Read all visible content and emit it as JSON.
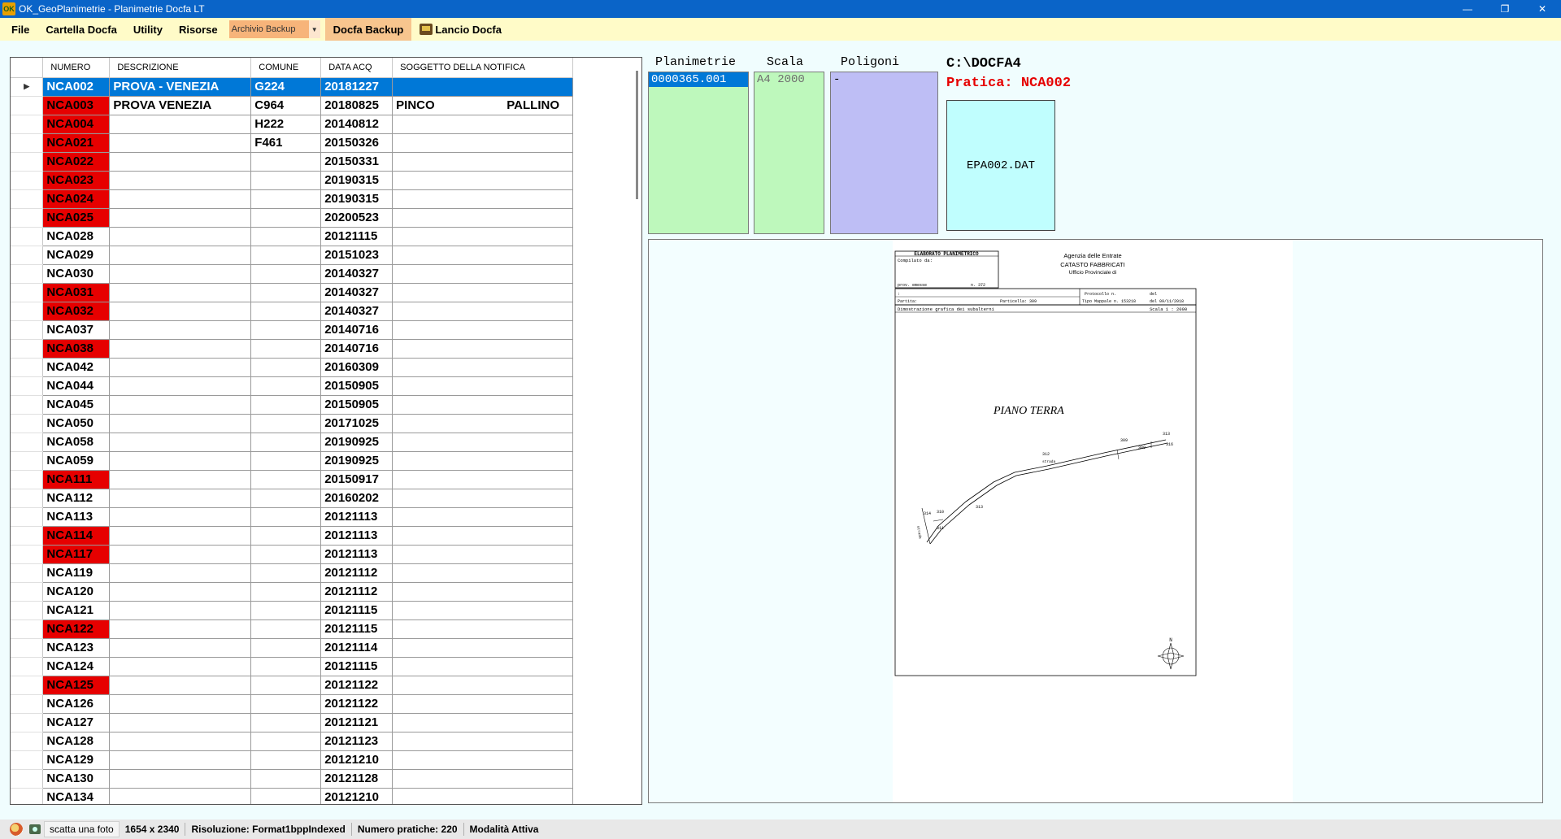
{
  "window": {
    "title": "OK_GeoPlanimetrie - Planimetrie Docfa LT",
    "app_icon": "OK",
    "minimize_icon": "—",
    "maximize_icon": "❐",
    "close_icon": "✕"
  },
  "menu": {
    "file": "File",
    "cartella": "Cartella Docfa",
    "utility": "Utility",
    "risorse": "Risorse",
    "archivio_combo": "Archivio Backup",
    "docfa_backup": "Docfa Backup",
    "lancio": "Lancio Docfa"
  },
  "grid": {
    "headers": [
      "NUMERO",
      "DESCRIZIONE",
      "COMUNE",
      "DATA ACQ",
      "SOGGETTO DELLA NOTIFICA"
    ],
    "row_indicator": "▶",
    "rows": [
      {
        "numero": "NCA002",
        "descrizione": "PROVA - VENEZIA",
        "comune": "G224",
        "data": "20181227",
        "sogg1": "",
        "sogg2": "",
        "red": false,
        "selected": true
      },
      {
        "numero": "NCA003",
        "descrizione": "PROVA VENEZIA",
        "comune": "C964",
        "data": "20180825",
        "sogg1": "PINCO",
        "sogg2": "PALLINO",
        "red": true
      },
      {
        "numero": "NCA004",
        "descrizione": "",
        "comune": "H222",
        "data": "20140812",
        "sogg1": "",
        "sogg2": "",
        "red": true
      },
      {
        "numero": "NCA021",
        "descrizione": "",
        "comune": "F461",
        "data": "20150326",
        "sogg1": "",
        "sogg2": "",
        "red": true
      },
      {
        "numero": "NCA022",
        "descrizione": "",
        "comune": "",
        "data": "20150331",
        "sogg1": "",
        "sogg2": "",
        "red": true
      },
      {
        "numero": "NCA023",
        "descrizione": "",
        "comune": "",
        "data": "20190315",
        "sogg1": "",
        "sogg2": "",
        "red": true
      },
      {
        "numero": "NCA024",
        "descrizione": "",
        "comune": "",
        "data": "20190315",
        "sogg1": "",
        "sogg2": "",
        "red": true
      },
      {
        "numero": "NCA025",
        "descrizione": "",
        "comune": "",
        "data": "20200523",
        "sogg1": "",
        "sogg2": "",
        "red": true
      },
      {
        "numero": "NCA028",
        "descrizione": "",
        "comune": "",
        "data": "20121115",
        "sogg1": "",
        "sogg2": "",
        "red": false
      },
      {
        "numero": "NCA029",
        "descrizione": "",
        "comune": "",
        "data": "20151023",
        "sogg1": "",
        "sogg2": "",
        "red": false
      },
      {
        "numero": "NCA030",
        "descrizione": "",
        "comune": "",
        "data": "20140327",
        "sogg1": "",
        "sogg2": "",
        "red": false
      },
      {
        "numero": "NCA031",
        "descrizione": "",
        "comune": "",
        "data": "20140327",
        "sogg1": "",
        "sogg2": "",
        "red": true
      },
      {
        "numero": "NCA032",
        "descrizione": "",
        "comune": "",
        "data": "20140327",
        "sogg1": "",
        "sogg2": "",
        "red": true
      },
      {
        "numero": "NCA037",
        "descrizione": "",
        "comune": "",
        "data": "20140716",
        "sogg1": "",
        "sogg2": "",
        "red": false
      },
      {
        "numero": "NCA038",
        "descrizione": "",
        "comune": "",
        "data": "20140716",
        "sogg1": "",
        "sogg2": "",
        "red": true
      },
      {
        "numero": "NCA042",
        "descrizione": "",
        "comune": "",
        "data": "20160309",
        "sogg1": "",
        "sogg2": "",
        "red": false
      },
      {
        "numero": "NCA044",
        "descrizione": "",
        "comune": "",
        "data": "20150905",
        "sogg1": "",
        "sogg2": "",
        "red": false
      },
      {
        "numero": "NCA045",
        "descrizione": "",
        "comune": "",
        "data": "20150905",
        "sogg1": "",
        "sogg2": "",
        "red": false
      },
      {
        "numero": "NCA050",
        "descrizione": "",
        "comune": "",
        "data": "20171025",
        "sogg1": "",
        "sogg2": "",
        "red": false
      },
      {
        "numero": "NCA058",
        "descrizione": "",
        "comune": "",
        "data": "20190925",
        "sogg1": "",
        "sogg2": "",
        "red": false
      },
      {
        "numero": "NCA059",
        "descrizione": "",
        "comune": "",
        "data": "20190925",
        "sogg1": "",
        "sogg2": "",
        "red": false
      },
      {
        "numero": "NCA111",
        "descrizione": "",
        "comune": "",
        "data": "20150917",
        "sogg1": "",
        "sogg2": "",
        "red": true
      },
      {
        "numero": "NCA112",
        "descrizione": "",
        "comune": "",
        "data": "20160202",
        "sogg1": "",
        "sogg2": "",
        "red": false
      },
      {
        "numero": "NCA113",
        "descrizione": "",
        "comune": "",
        "data": "20121113",
        "sogg1": "",
        "sogg2": "",
        "red": false
      },
      {
        "numero": "NCA114",
        "descrizione": "",
        "comune": "",
        "data": "20121113",
        "sogg1": "",
        "sogg2": "",
        "red": true
      },
      {
        "numero": "NCA117",
        "descrizione": "",
        "comune": "",
        "data": "20121113",
        "sogg1": "",
        "sogg2": "",
        "red": true
      },
      {
        "numero": "NCA119",
        "descrizione": "",
        "comune": "",
        "data": "20121112",
        "sogg1": "",
        "sogg2": "",
        "red": false
      },
      {
        "numero": "NCA120",
        "descrizione": "",
        "comune": "",
        "data": "20121112",
        "sogg1": "",
        "sogg2": "",
        "red": false
      },
      {
        "numero": "NCA121",
        "descrizione": "",
        "comune": "",
        "data": "20121115",
        "sogg1": "",
        "sogg2": "",
        "red": false
      },
      {
        "numero": "NCA122",
        "descrizione": "",
        "comune": "",
        "data": "20121115",
        "sogg1": "",
        "sogg2": "",
        "red": true
      },
      {
        "numero": "NCA123",
        "descrizione": "",
        "comune": "",
        "data": "20121114",
        "sogg1": "",
        "sogg2": "",
        "red": false
      },
      {
        "numero": "NCA124",
        "descrizione": "",
        "comune": "",
        "data": "20121115",
        "sogg1": "",
        "sogg2": "",
        "red": false
      },
      {
        "numero": "NCA125",
        "descrizione": "",
        "comune": "",
        "data": "20121122",
        "sogg1": "",
        "sogg2": "",
        "red": true
      },
      {
        "numero": "NCA126",
        "descrizione": "",
        "comune": "",
        "data": "20121122",
        "sogg1": "",
        "sogg2": "",
        "red": false
      },
      {
        "numero": "NCA127",
        "descrizione": "",
        "comune": "",
        "data": "20121121",
        "sogg1": "",
        "sogg2": "",
        "red": false
      },
      {
        "numero": "NCA128",
        "descrizione": "",
        "comune": "",
        "data": "20121123",
        "sogg1": "",
        "sogg2": "",
        "red": false
      },
      {
        "numero": "NCA129",
        "descrizione": "",
        "comune": "",
        "data": "20121210",
        "sogg1": "",
        "sogg2": "",
        "red": false
      },
      {
        "numero": "NCA130",
        "descrizione": "",
        "comune": "",
        "data": "20121128",
        "sogg1": "",
        "sogg2": "",
        "red": false
      },
      {
        "numero": "NCA134",
        "descrizione": "",
        "comune": "",
        "data": "20121210",
        "sogg1": "",
        "sogg2": "",
        "red": false
      }
    ]
  },
  "lists": {
    "planimetrie_label": "Planimetrie",
    "scala_label": "Scala",
    "poligoni_label": "Poligoni",
    "planimetrie_items": [
      "0000365.001"
    ],
    "scala_items": [
      "A4 2000"
    ],
    "poligoni_items": [
      "-"
    ]
  },
  "info": {
    "path": "C:\\DOCFA4",
    "pratica": "Pratica: NCA002",
    "dat_file": "EPA002.DAT"
  },
  "sheet": {
    "header_title": "ELABORATO PLANIMETRICO",
    "compilato": "Compilato da:",
    "prov": "prov. emesse",
    "n": "n. 372",
    "agenzia": "Agenzia delle Entrate",
    "catasto": "CATASTO FABBRICATI",
    "ufficio": "Ufficio Provinciale di",
    "protocollo": "Protocollo n.",
    "del1": "del",
    "partita": "Partita:",
    "particella": "Particella: 309",
    "tipo": "Tipo Mappale n. 153218",
    "del2": "del 09/11/2018",
    "dimostrazione": "Dimostrazione grafica dei subalterni",
    "scala": "Scala 1 : 2000",
    "piano": "PIANO TERRA",
    "strada1": "strada",
    "strada2": "strada",
    "labels": [
      "313",
      "309",
      "300",
      "316",
      "312",
      "313",
      "314",
      "310",
      "311"
    ],
    "north": "N"
  },
  "status": {
    "photo_btn": "scatta una foto",
    "dimensioni": "1654 x 2340",
    "risoluzione": "Risoluzione:  Format1bppIndexed",
    "numero": "Numero pratiche: 220",
    "modalita": "Modalità Attiva"
  }
}
